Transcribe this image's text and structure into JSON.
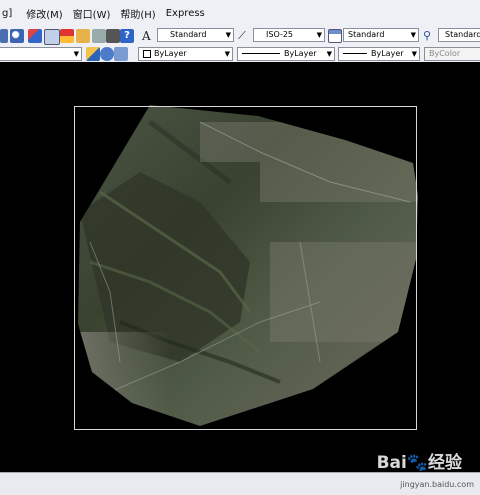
{
  "menu": {
    "left_fragment": "g]",
    "items": [
      "修改(M)",
      "窗口(W)",
      "帮助(H)",
      "Express"
    ]
  },
  "styles_toolbar": {
    "text_style": "Standard",
    "dim_style": "ISO-25",
    "table_style": "Standard",
    "multileader_style": "Standard"
  },
  "properties_toolbar": {
    "layer_value": "",
    "color": "ByLayer",
    "linetype": "ByLayer",
    "lineweight": "ByLayer",
    "plot_style": "ByColor"
  },
  "watermark": {
    "brand": "Bai",
    "suffix": "经验",
    "sub": "jingyan.baidu.com"
  }
}
